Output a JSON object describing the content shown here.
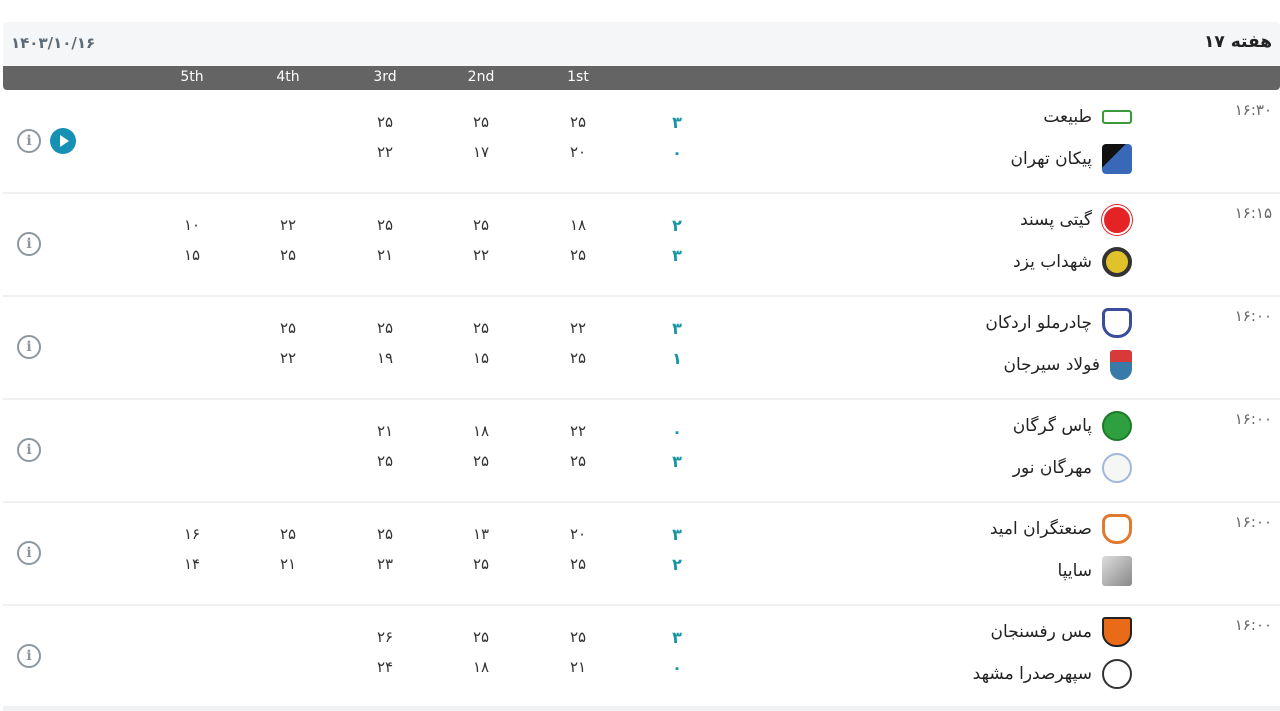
{
  "header": {
    "week_title": "هفته ۱۷",
    "date": "۱۴۰۳/۱۰/۱۶"
  },
  "set_headers": [
    "1st",
    "2nd",
    "3rd",
    "4th",
    "5th"
  ],
  "colors": {
    "accent": "#1595a5",
    "header_bar": "#646464",
    "play_button": "#1691b3"
  },
  "matches": [
    {
      "time": "۱۶:۳۰",
      "home": {
        "name": "طبیعت",
        "logo": "tabiat-logo",
        "score": "۳",
        "sets": [
          "۲۵",
          "۲۵",
          "۲۵",
          "",
          ""
        ]
      },
      "away": {
        "name": "پیکان تهران",
        "logo": "paykan-logo",
        "score": "۰",
        "sets": [
          "۲۰",
          "۱۷",
          "۲۲",
          "",
          ""
        ]
      },
      "has_video": true
    },
    {
      "time": "۱۶:۱۵",
      "home": {
        "name": "گیتی پسند",
        "logo": "giti-pasand-logo",
        "score": "۲",
        "sets": [
          "۱۸",
          "۲۵",
          "۲۵",
          "۲۲",
          "۱۰"
        ]
      },
      "away": {
        "name": "شهداب یزد",
        "logo": "shahdab-logo",
        "score": "۳",
        "sets": [
          "۲۵",
          "۲۲",
          "۲۱",
          "۲۵",
          "۱۵"
        ]
      },
      "has_video": false
    },
    {
      "time": "۱۶:۰۰",
      "home": {
        "name": "چادرملو اردکان",
        "logo": "chadormalu-logo",
        "score": "۳",
        "sets": [
          "۲۲",
          "۲۵",
          "۲۵",
          "۲۵",
          ""
        ]
      },
      "away": {
        "name": "فولاد سیرجان",
        "logo": "foolad-logo",
        "score": "۱",
        "sets": [
          "۲۵",
          "۱۵",
          "۱۹",
          "۲۲",
          ""
        ]
      },
      "has_video": false
    },
    {
      "time": "۱۶:۰۰",
      "home": {
        "name": "پاس گرگان",
        "logo": "paas-logo",
        "score": "۰",
        "sets": [
          "۲۲",
          "۱۸",
          "۲۱",
          "",
          ""
        ]
      },
      "away": {
        "name": "مهرگان نور",
        "logo": "mehregan-logo",
        "score": "۳",
        "sets": [
          "۲۵",
          "۲۵",
          "۲۵",
          "",
          ""
        ]
      },
      "has_video": false
    },
    {
      "time": "۱۶:۰۰",
      "home": {
        "name": "صنعتگران امید",
        "logo": "sanatgaran-logo",
        "score": "۳",
        "sets": [
          "۲۰",
          "۱۳",
          "۲۵",
          "۲۵",
          "۱۶"
        ]
      },
      "away": {
        "name": "سایپا",
        "logo": "saipa-logo",
        "score": "۲",
        "sets": [
          "۲۵",
          "۲۵",
          "۲۳",
          "۲۱",
          "۱۴"
        ]
      },
      "has_video": false
    },
    {
      "time": "۱۶:۰۰",
      "home": {
        "name": "مس رفسنجان",
        "logo": "mes-logo",
        "score": "۳",
        "sets": [
          "۲۵",
          "۲۵",
          "۲۶",
          "",
          ""
        ]
      },
      "away": {
        "name": "سپهرصدرا مشهد",
        "logo": "sepehr-logo",
        "score": "۰",
        "sets": [
          "۲۱",
          "۱۸",
          "۲۴",
          "",
          ""
        ]
      },
      "has_video": false
    }
  ]
}
